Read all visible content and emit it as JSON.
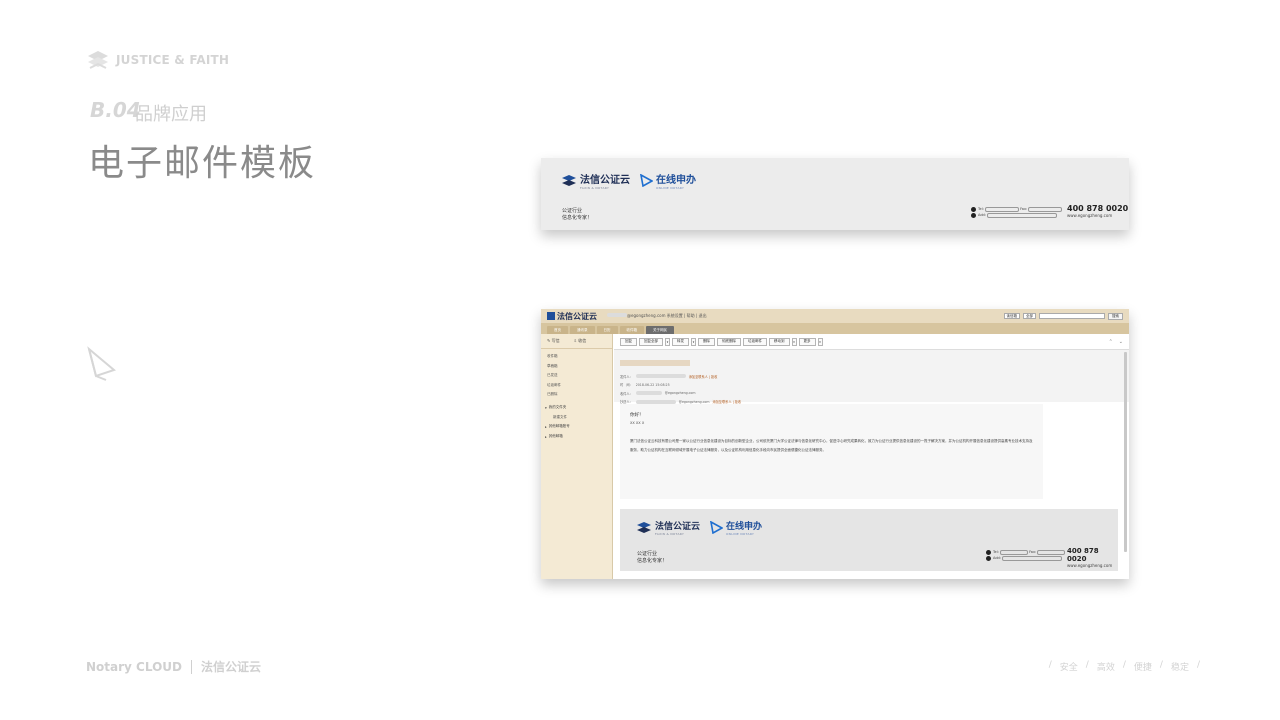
{
  "brand": {
    "text": "JUSTICE & FAITH"
  },
  "section": {
    "code": "B.04",
    "subtitle": "品牌应用"
  },
  "page": {
    "title": "电子邮件模板"
  },
  "signature": {
    "logo1_text": "法信公证云",
    "logo1_sub": "FAXIN & NOTARY",
    "logo2_text": "在线申办",
    "logo2_sub": "ONLINE NOTARY",
    "slogan_line1": "公证行业",
    "slogan_line2": "信息化专家！",
    "tel_label": "Tel:",
    "fax_label": "Fax:",
    "add_label": "Add:",
    "phone": "400 878 0020",
    "url": "www.egongzheng.com"
  },
  "mail": {
    "logo_text": "法信公证云",
    "user_domain": "@egongzheng.com",
    "user_links": "系统设置 | 帮助 | 退出",
    "search_scope": "读信箱",
    "search_type": "全部",
    "search_button": "搜索",
    "tabs": [
      {
        "label": "首页"
      },
      {
        "label": "通讯录"
      },
      {
        "label": "日历"
      },
      {
        "label": "收件箱"
      },
      {
        "label": "关于网民"
      }
    ],
    "side_actions": {
      "compose": "写信",
      "receive": "收信"
    },
    "folders": [
      "收件箱",
      "草稿箱",
      "已发送",
      "垃圾邮件",
      "已删除"
    ],
    "groups": [
      {
        "label": "我的文件夹",
        "sub": [
          "新建文件"
        ]
      },
      {
        "label": "其他邮箱账号"
      },
      {
        "label": "其他邮箱"
      }
    ],
    "toolbar": [
      "回复",
      "回复全部",
      "转发",
      "删除",
      "彻底删除",
      "垃圾邮件",
      "移动到",
      "更多"
    ],
    "from_label": "发件人：",
    "from_link": "添加至联系人 | 拒收",
    "time_label": "时　间：",
    "time_value": "2018-06-22 15:08:25",
    "to_label": "收件人：",
    "to_value": "@egongzheng.com",
    "cc_label": "抄送人：",
    "cc_value": "@egongzheng.com",
    "cc_link": "添加至联系人 | 拒收",
    "greeting": "你好！",
    "sign_line": "XX XX X",
    "body": "厦门法信公证云科技有限公司是一家以公证行业信息化建设为目标的创新型企业，公司依托厦门大学公证法律与信息化研究中心，促进中心研究成果转化，致力为公证行业提供信息化建设的一揽子解决方案，并为公证机构开展信息化建设提供高素专业技术支持及服务，助力公证机构在互联网领域开展电子公证法律服务，以及公证机构利用信息化手段向市民提供全面便捷化公证法律服务。"
  },
  "footer": {
    "left_en": "Notary CLOUD",
    "left_cn": "法信公证云",
    "values": [
      "安全",
      "高效",
      "便捷",
      "稳定"
    ]
  }
}
